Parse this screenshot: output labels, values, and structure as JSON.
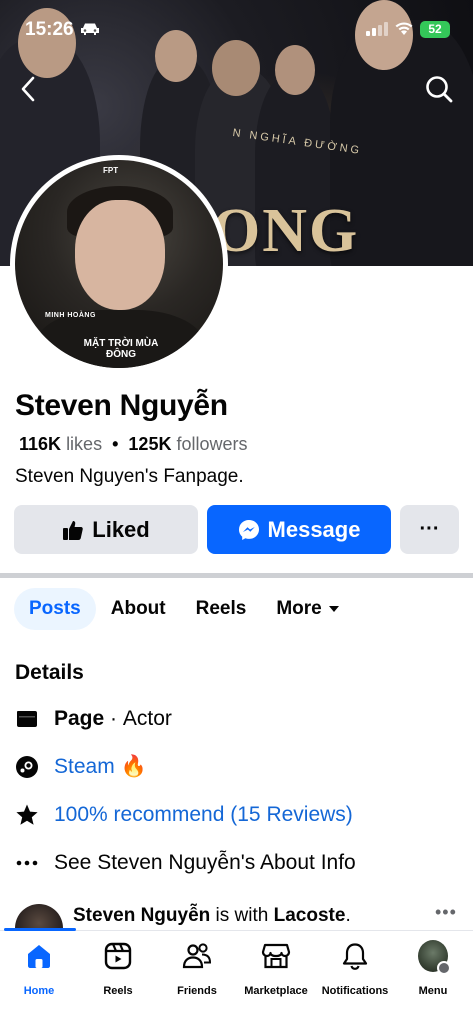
{
  "status": {
    "time": "15:26",
    "battery": "52"
  },
  "cover": {
    "title_text": "ONG",
    "subtitle_text": "N NGHĨA ĐƯỜNG"
  },
  "avatar": {
    "brand_text": "FPT",
    "caption_name": "MINH HOÀNG",
    "caption_title": "MẶT TRỜI MÙA ĐÔNG"
  },
  "profile": {
    "name": "Steven Nguyễn",
    "likes_count": "116K",
    "likes_label": "likes",
    "bullet": "•",
    "followers_count": "125K",
    "followers_label": "followers",
    "bio": "Steven Nguyen's Fanpage."
  },
  "actions": {
    "liked_label": "Liked",
    "message_label": "Message",
    "more_label": "···"
  },
  "tabs": [
    {
      "label": "Posts",
      "active": true
    },
    {
      "label": "About",
      "active": false
    },
    {
      "label": "Reels",
      "active": false
    },
    {
      "label": "More",
      "active": false
    }
  ],
  "details": {
    "title": "Details",
    "page_label": "Page",
    "page_separator": " · ",
    "page_category": "Actor",
    "steam_label": "Steam 🔥",
    "recommend_label": "100% recommend (15 Reviews)",
    "about_label": "See Steven Nguyễn's About Info"
  },
  "post_preview": {
    "author": "Steven Nguyễn",
    "connector": " is with ",
    "tagged": "Lacoste",
    "end": ".",
    "more": "•••"
  },
  "bottom_nav": [
    {
      "label": "Home",
      "icon": "home-icon",
      "active": true
    },
    {
      "label": "Reels",
      "icon": "reels-icon",
      "active": false
    },
    {
      "label": "Friends",
      "icon": "friends-icon",
      "active": false
    },
    {
      "label": "Marketplace",
      "icon": "marketplace-icon",
      "active": false
    },
    {
      "label": "Notifications",
      "icon": "bell-icon",
      "active": false
    },
    {
      "label": "Menu",
      "icon": "menu-avatar-icon",
      "active": false
    }
  ],
  "colors": {
    "accent": "#0866ff",
    "link": "#1467d6",
    "button_gray": "#e4e6eb",
    "secondary_text": "#65676b"
  }
}
